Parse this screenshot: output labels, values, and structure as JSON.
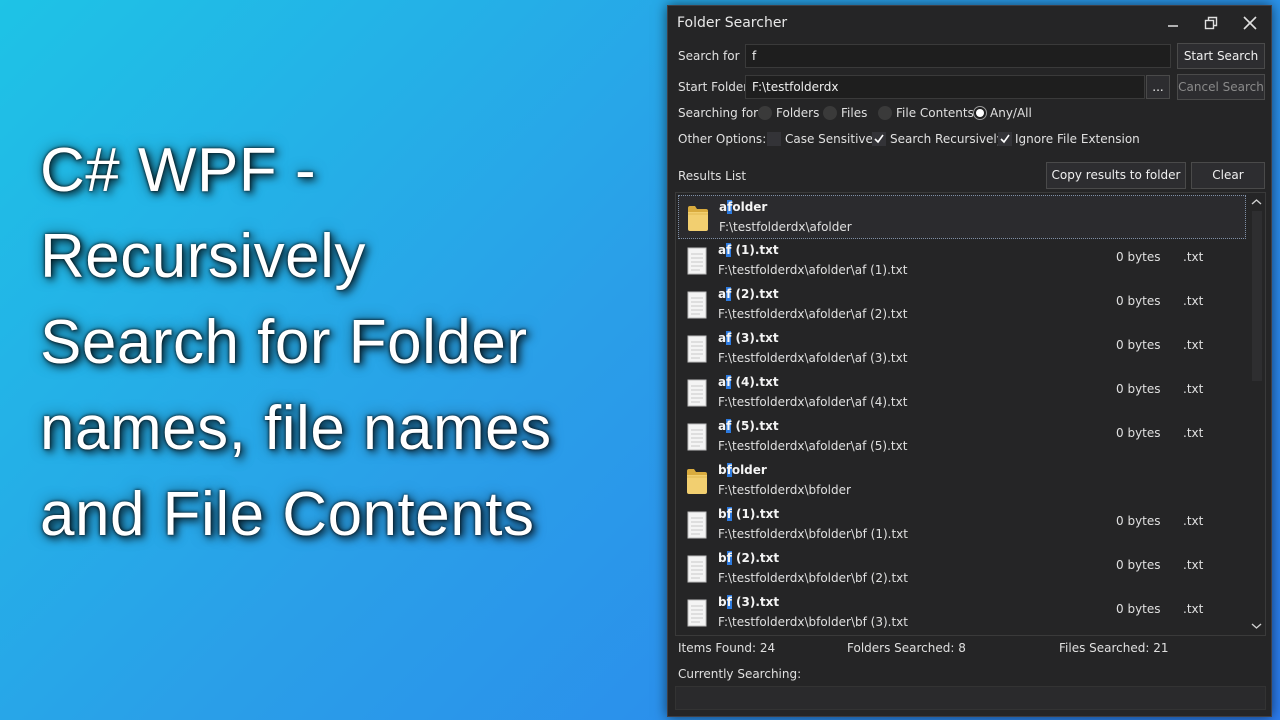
{
  "headline": {
    "line1": "C# WPF -",
    "line2": "Recursively",
    "line3": "Search for Folder",
    "line4": "names, file names",
    "line5": "and File Contents"
  },
  "window": {
    "title": "Folder Searcher"
  },
  "search": {
    "search_for_label": "Search for",
    "search_for_value": "f",
    "start_folder_label": "Start Folder",
    "start_folder_value": "F:\\testfolderdx",
    "browse_label": "...",
    "start_button": "Start Search",
    "cancel_button": "Cancel Search"
  },
  "searching_for": {
    "label": "Searching for:",
    "options": [
      {
        "label": "Folders",
        "selected": false
      },
      {
        "label": "Files",
        "selected": false
      },
      {
        "label": "File Contents",
        "selected": false
      },
      {
        "label": "Any/All",
        "selected": true
      }
    ]
  },
  "other_options": {
    "label": "Other Options:",
    "options": [
      {
        "label": "Case Sensitive",
        "checked": false
      },
      {
        "label": "Search Recursively",
        "checked": true
      },
      {
        "label": "Ignore File Extension",
        "checked": true
      }
    ]
  },
  "results": {
    "label": "Results List",
    "copy_button": "Copy results to folder",
    "clear_button": "Clear",
    "items": [
      {
        "icon": "folder-icon",
        "pre": "a",
        "hl": "f",
        "post": "older",
        "path": "F:\\testfolderdx\\afolder",
        "size": "",
        "ext": ""
      },
      {
        "icon": "text-file-icon",
        "pre": "a",
        "hl": "f",
        "post": " (1).txt",
        "path": "F:\\testfolderdx\\afolder\\af (1).txt",
        "size": "0 bytes",
        "ext": ".txt"
      },
      {
        "icon": "text-file-icon",
        "pre": "a",
        "hl": "f",
        "post": " (2).txt",
        "path": "F:\\testfolderdx\\afolder\\af (2).txt",
        "size": "0 bytes",
        "ext": ".txt"
      },
      {
        "icon": "text-file-icon",
        "pre": "a",
        "hl": "f",
        "post": " (3).txt",
        "path": "F:\\testfolderdx\\afolder\\af (3).txt",
        "size": "0 bytes",
        "ext": ".txt"
      },
      {
        "icon": "text-file-icon",
        "pre": "a",
        "hl": "f",
        "post": " (4).txt",
        "path": "F:\\testfolderdx\\afolder\\af (4).txt",
        "size": "0 bytes",
        "ext": ".txt"
      },
      {
        "icon": "text-file-icon",
        "pre": "a",
        "hl": "f",
        "post": " (5).txt",
        "path": "F:\\testfolderdx\\afolder\\af (5).txt",
        "size": "0 bytes",
        "ext": ".txt"
      },
      {
        "icon": "folder-icon",
        "pre": "b",
        "hl": "f",
        "post": "older",
        "path": "F:\\testfolderdx\\bfolder",
        "size": "",
        "ext": ""
      },
      {
        "icon": "text-file-icon",
        "pre": "b",
        "hl": "f",
        "post": " (1).txt",
        "path": "F:\\testfolderdx\\bfolder\\bf (1).txt",
        "size": "0 bytes",
        "ext": ".txt"
      },
      {
        "icon": "text-file-icon",
        "pre": "b",
        "hl": "f",
        "post": " (2).txt",
        "path": "F:\\testfolderdx\\bfolder\\bf (2).txt",
        "size": "0 bytes",
        "ext": ".txt"
      },
      {
        "icon": "text-file-icon",
        "pre": "b",
        "hl": "f",
        "post": " (3).txt",
        "path": "F:\\testfolderdx\\bfolder\\bf (3).txt",
        "size": "0 bytes",
        "ext": ".txt"
      }
    ]
  },
  "stats": {
    "items_found": "Items Found: 24",
    "folders_searched": "Folders Searched: 8",
    "files_searched": "Files Searched: 21",
    "currently_searching": "Currently Searching:"
  },
  "colors": {
    "highlight": "#2d7be0",
    "window_bg": "#252526",
    "folder": "#e8c46a"
  }
}
